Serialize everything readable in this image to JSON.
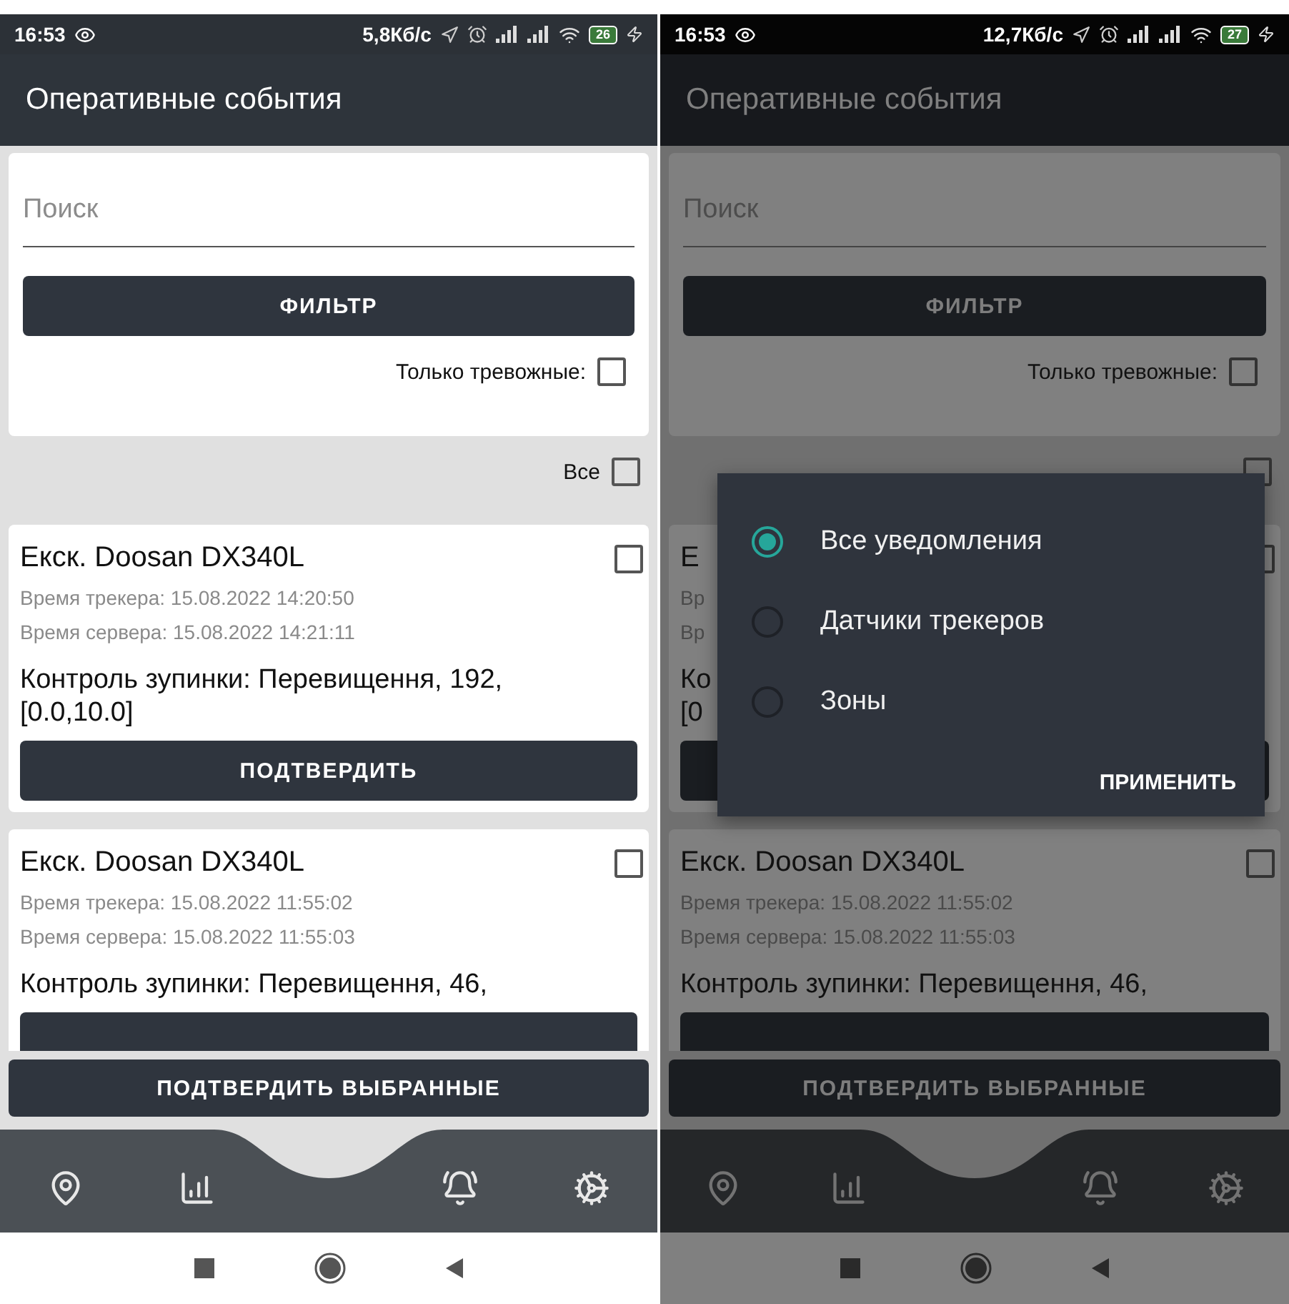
{
  "phones": [
    {
      "status_bar": {
        "time": "16:53",
        "net_speed": "5,8Кб/с",
        "battery": "26"
      },
      "title": "Оперативные события",
      "search": {
        "placeholder": "Поиск"
      },
      "filter_button": "ФИЛЬТР",
      "alarm_only": {
        "label": "Только тревожные:",
        "checked": false
      },
      "select_all": {
        "label": "Все",
        "checked": false
      },
      "events": [
        {
          "title": "Екск. Doosan DX340L",
          "tracker_time": "Время трекера: 15.08.2022 14:20:50",
          "server_time": "Время сервера: 15.08.2022 14:21:11",
          "description": [
            "Контроль зупинки: Перевищення, 192,",
            "[0.0,10.0]"
          ],
          "checked": false,
          "confirm_button": "ПОДТВЕРДИТЬ"
        },
        {
          "title": "Екск. Doosan DX340L",
          "tracker_time": "Время трекера: 15.08.2022 11:55:02",
          "server_time": "Время сервера: 15.08.2022 11:55:03",
          "description": [
            "Контроль зупинки: Перевищення, 46,"
          ],
          "checked": false
        }
      ],
      "confirm_selected_button": "ПОДТВЕРДИТЬ ВЫБРАННЫЕ"
    },
    {
      "status_bar": {
        "time": "16:53",
        "net_speed": "12,7Кб/с",
        "battery": "27"
      },
      "title": "Оперативные события",
      "search": {
        "placeholder": "Поиск"
      },
      "filter_button": "ФИЛЬТР",
      "alarm_only": {
        "label": "Только тревожные:",
        "checked": false
      },
      "select_all": {
        "checked": false
      },
      "events": [
        {
          "title": "Е",
          "tracker_time": "Вр",
          "server_time": "Вр",
          "description": [
            "Ко",
            "[0"
          ],
          "checked": false
        },
        {
          "title": "Екск. Doosan DX340L",
          "tracker_time": "Время трекера: 15.08.2022 11:55:02",
          "server_time": "Время сервера: 15.08.2022 11:55:03",
          "description": [
            "Контроль зупинки: Перевищення, 46,"
          ],
          "checked": false
        }
      ],
      "confirm_selected_button": "ПОДТВЕРДИТЬ ВЫБРАННЫЕ",
      "dialog": {
        "options": [
          {
            "label": "Все уведомления",
            "selected": true
          },
          {
            "label": "Датчики трекеров",
            "selected": false
          },
          {
            "label": "Зоны",
            "selected": false
          }
        ],
        "apply_button": "ПРИМЕНИТЬ"
      }
    }
  ]
}
